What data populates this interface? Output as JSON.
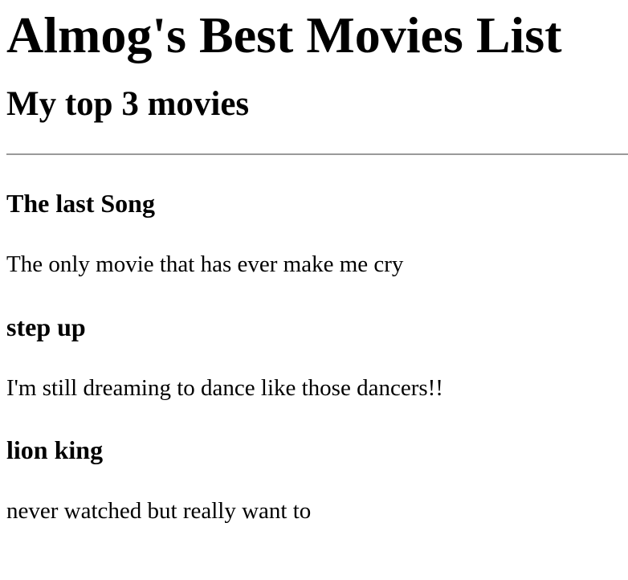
{
  "page": {
    "title": "Almog's Best Movies List",
    "subtitle": "My top 3 movies"
  },
  "movies": [
    {
      "title": "The last Song",
      "description": "The only movie that has ever make me cry"
    },
    {
      "title": "step up",
      "description": "I'm still dreaming to dance like those dancers!!"
    },
    {
      "title": "lion king",
      "description": "never watched but really want to"
    }
  ]
}
